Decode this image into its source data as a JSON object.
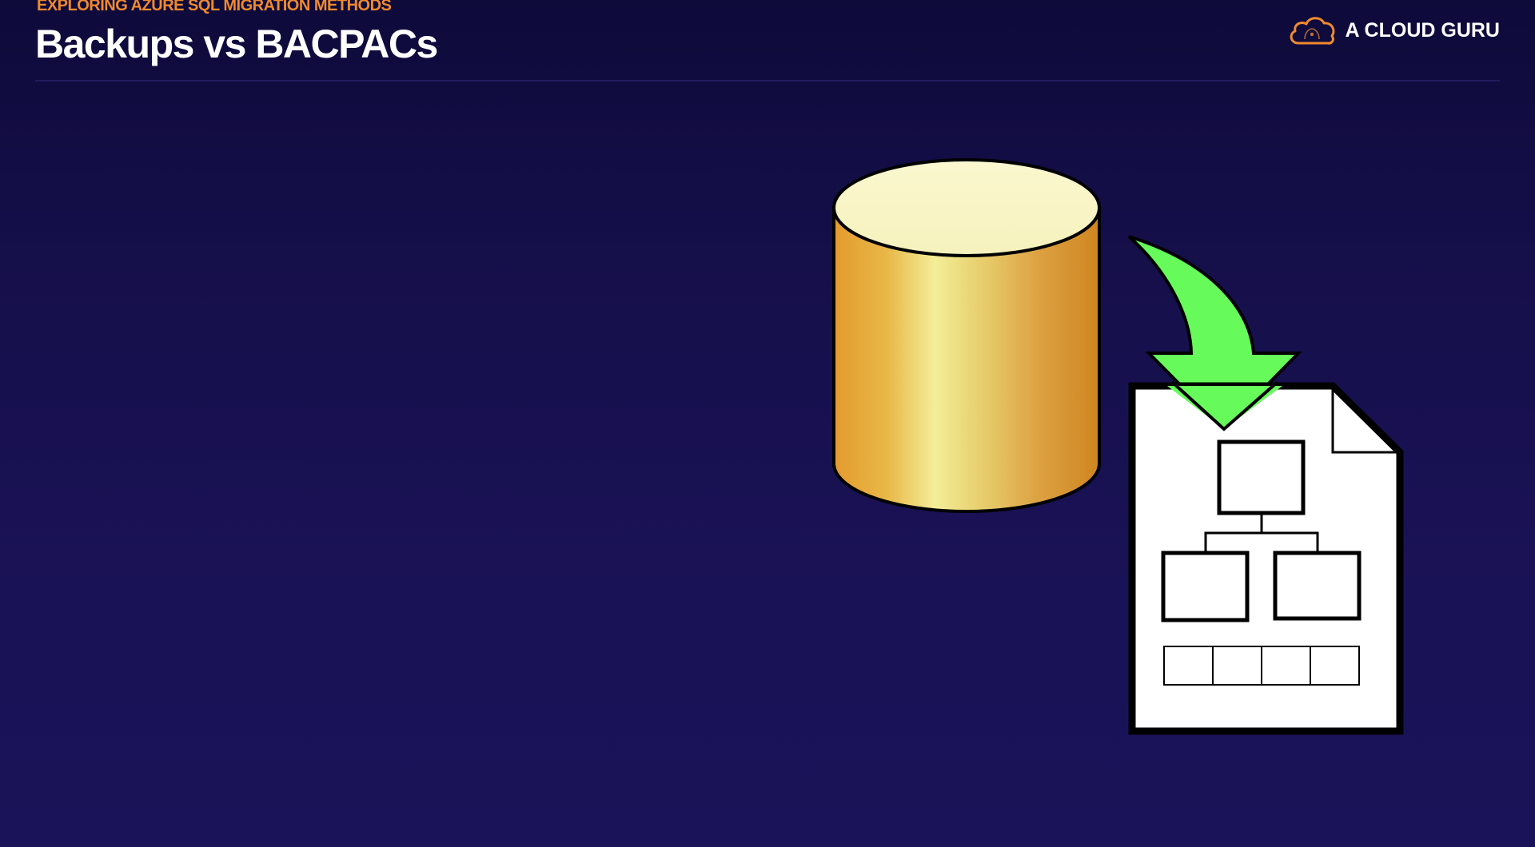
{
  "slide": {
    "kicker": "EXPLORING AZURE SQL MIGRATION METHODS",
    "title": "Backups vs BACPACs"
  },
  "brand": {
    "name": "A CLOUD GURU",
    "logo_icon": "cloud-logo-icon",
    "accent_color": "#f08a2c"
  },
  "illustration": {
    "database_icon": "database-cylinder-icon",
    "arrow_icon": "curved-down-arrow-icon",
    "file_icon": "schema-file-icon",
    "colors": {
      "database": "#e9a83a",
      "database_top": "#f9f5c4",
      "arrow": "#66fb5a",
      "file": "#ffffff"
    }
  }
}
